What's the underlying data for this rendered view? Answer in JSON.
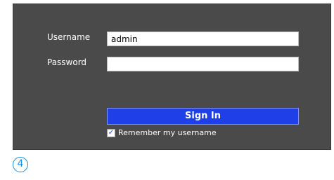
{
  "login": {
    "username_label": "Username",
    "password_label": "Password",
    "username_value": "admin",
    "password_value": "",
    "signin_label": "Sign In",
    "remember_label": "Remember my username",
    "remember_checked": true
  },
  "step_marker": "4",
  "colors": {
    "panel_bg": "#4a4a4a",
    "button_bg": "#1f3fe8",
    "step_marker": "#1a8ad4"
  }
}
